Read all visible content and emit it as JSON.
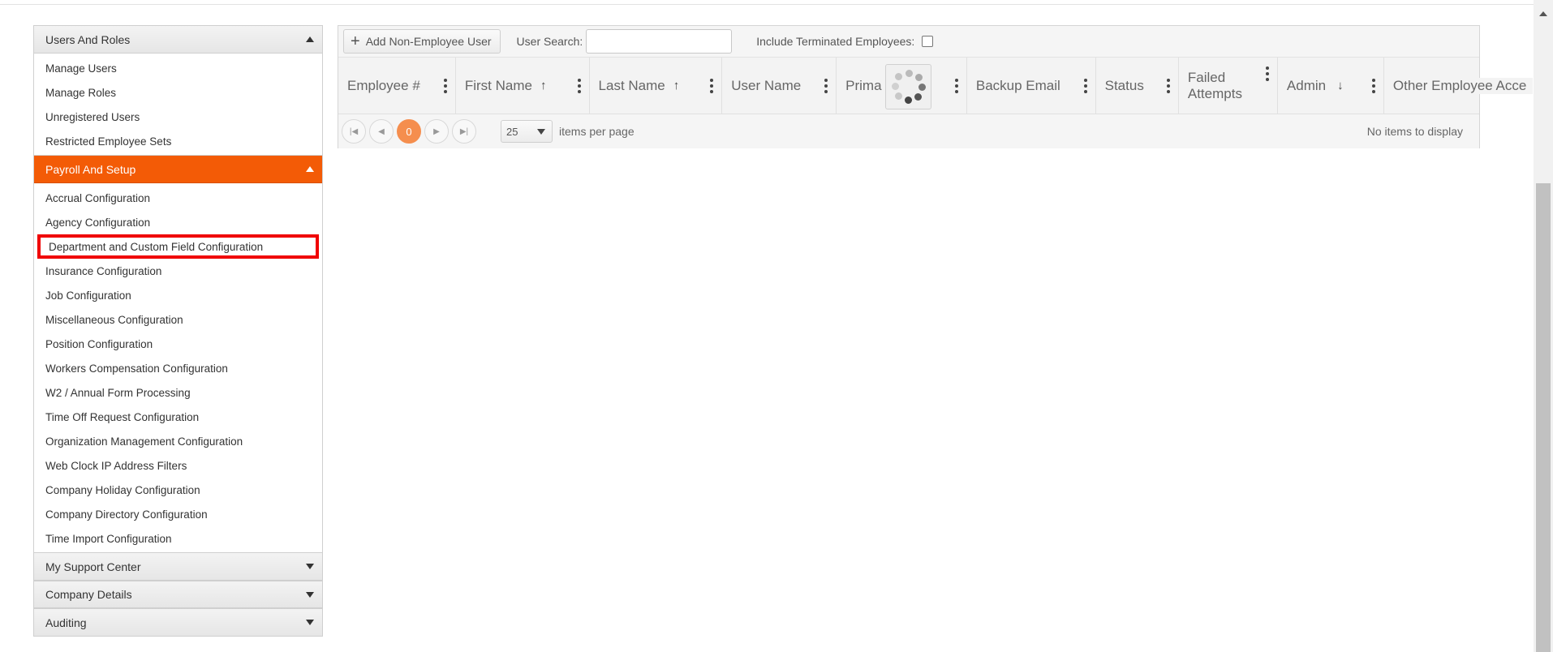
{
  "sidebar": {
    "sections": [
      {
        "title": "Users And Roles",
        "expanded": true,
        "items": [
          "Manage Users",
          "Manage Roles",
          "Unregistered Users",
          "Restricted Employee Sets"
        ]
      },
      {
        "title": "Payroll And Setup",
        "expanded": true,
        "active": true,
        "items": [
          "Accrual Configuration",
          "Agency Configuration",
          "Department and Custom Field Configuration",
          "Insurance Configuration",
          "Job Configuration",
          "Miscellaneous Configuration",
          "Position Configuration",
          "Workers Compensation Configuration",
          "W2 / Annual Form Processing",
          "Time Off Request Configuration",
          "Organization Management Configuration",
          "Web Clock IP Address Filters",
          "Company Holiday Configuration",
          "Company Directory Configuration",
          "Time Import Configuration"
        ]
      },
      {
        "title": "My Support Center",
        "expanded": false
      },
      {
        "title": "Company Details",
        "expanded": false
      },
      {
        "title": "Auditing",
        "expanded": false
      }
    ]
  },
  "toolbar": {
    "add_label": "Add Non-Employee User",
    "search_label": "User Search:",
    "search_value": "",
    "terminated_label": "Include Terminated Employees:"
  },
  "columns": [
    {
      "label": "Employee #",
      "sort": ""
    },
    {
      "label": "First Name",
      "sort": "↑"
    },
    {
      "label": "Last Name",
      "sort": "↑"
    },
    {
      "label": "User Name",
      "sort": ""
    },
    {
      "label": "Prima",
      "label_tail": "l",
      "sort": ""
    },
    {
      "label": "Backup Email",
      "sort": ""
    },
    {
      "label": "Status",
      "sort": ""
    },
    {
      "label": "Failed",
      "label2": "Attempts",
      "sort": ""
    },
    {
      "label": "Admin",
      "sort": "↓"
    },
    {
      "label": "Other Employee Acce",
      "sort": ""
    }
  ],
  "pager": {
    "current_page": "0",
    "per_page": "25",
    "per_page_label": "items per page",
    "status": "No items to display"
  },
  "colors": {
    "accent": "#f35b06",
    "highlight": "#f00101",
    "page_current": "#f58e4e"
  }
}
